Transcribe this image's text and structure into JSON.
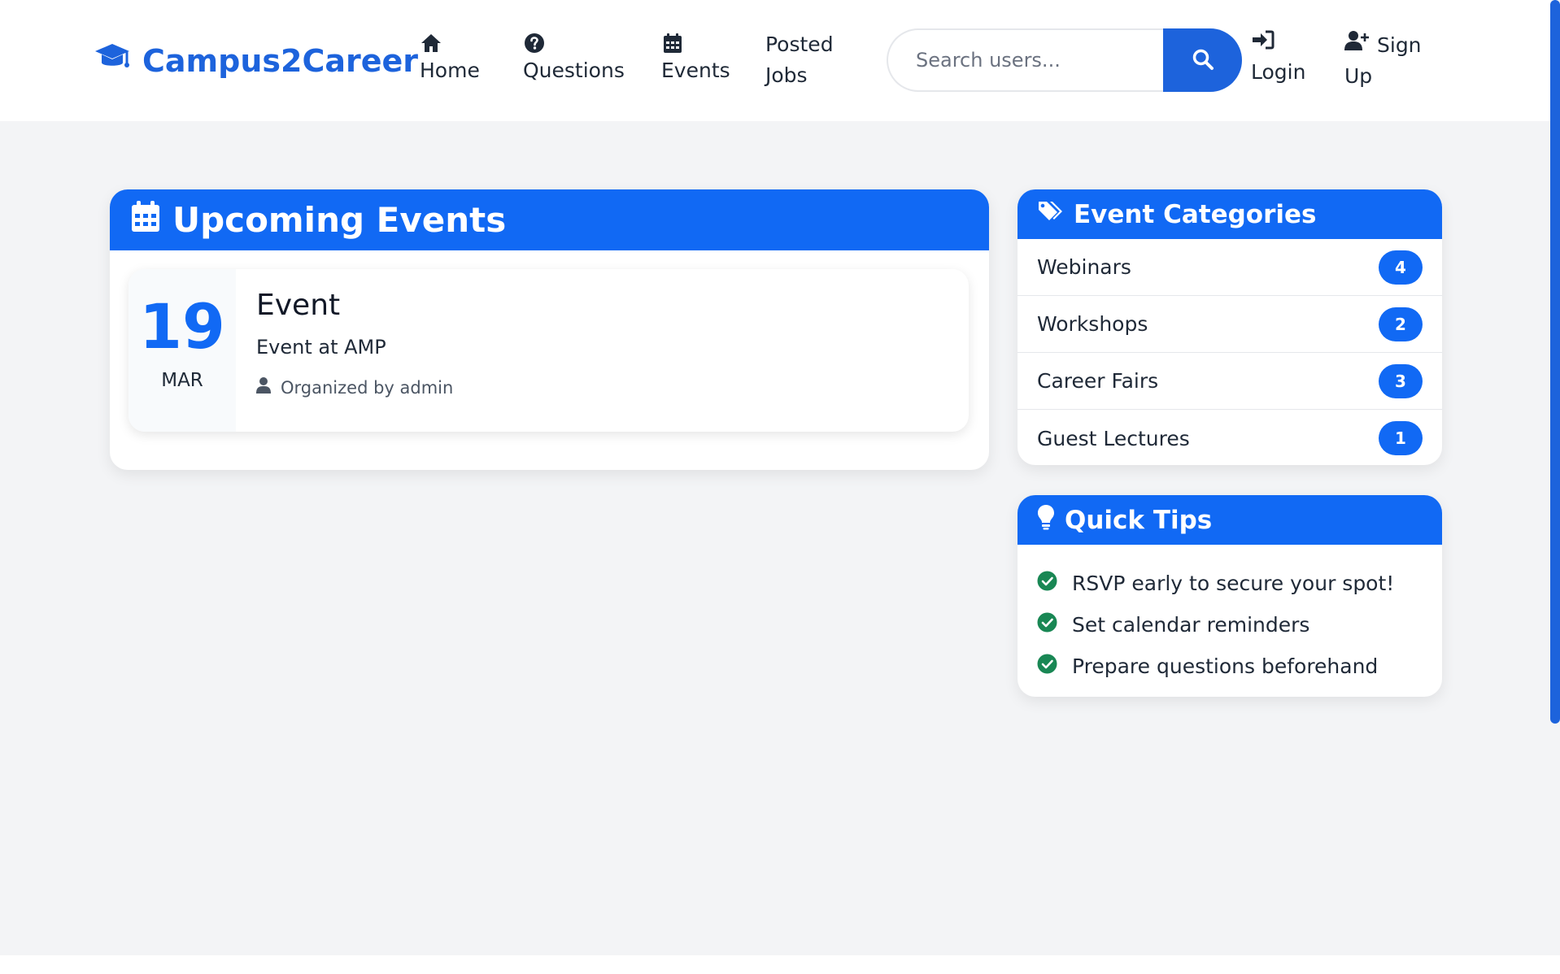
{
  "brand": {
    "name": "Campus2Career",
    "icon": "graduation-cap-icon"
  },
  "nav": {
    "home": {
      "label": "Home",
      "icon": "home-icon"
    },
    "questions": {
      "label": "Questions",
      "icon": "question-circle-icon"
    },
    "events": {
      "label": "Events",
      "icon": "calendar-icon"
    },
    "jobs": {
      "line1": "Posted",
      "line2": "Jobs"
    }
  },
  "search": {
    "placeholder": "Search users...",
    "value": "",
    "icon": "search-icon"
  },
  "auth": {
    "login": {
      "label": "Login",
      "icon": "sign-in-icon"
    },
    "signup": {
      "line1": "Sign",
      "line2": "Up",
      "icon": "user-plus-icon"
    }
  },
  "upcoming": {
    "title": "Upcoming Events",
    "icon": "calendar-icon",
    "events": [
      {
        "day": "19",
        "month": "MAR",
        "title": "Event",
        "location": "Event at AMP",
        "organizer": "Organized by admin"
      }
    ]
  },
  "categories": {
    "title": "Event Categories",
    "icon": "tags-icon",
    "items": [
      {
        "label": "Webinars",
        "count": "4"
      },
      {
        "label": "Workshops",
        "count": "2"
      },
      {
        "label": "Career Fairs",
        "count": "3"
      },
      {
        "label": "Guest Lectures",
        "count": "1"
      }
    ]
  },
  "tips": {
    "title": "Quick Tips",
    "icon": "lightbulb-icon",
    "items": [
      "RSVP early to secure your spot!",
      "Set calendar reminders",
      "Prepare questions beforehand"
    ]
  },
  "colors": {
    "primary": "#1169f4",
    "brand": "#1d63dc",
    "success": "#198754",
    "background": "#f3f4f6"
  }
}
